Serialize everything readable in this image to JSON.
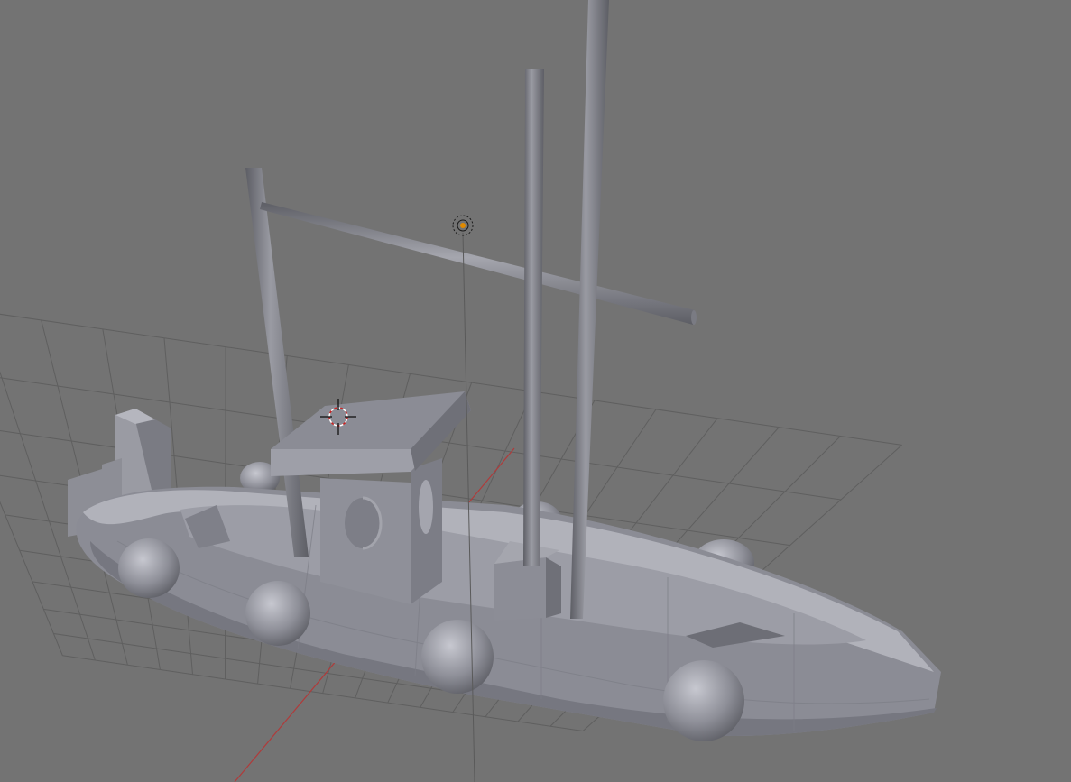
{
  "viewport": {
    "background_color": "#737373",
    "grid_color": "#5f5f5f",
    "x_axis_color": "#b03a3a",
    "mesh_color": "#8a8b94",
    "mesh_light_color": "#a4a5ae",
    "mesh_dark_color": "#6a6b73"
  },
  "scene": {
    "objects": [
      {
        "name": "boat-hull",
        "type": "mesh"
      },
      {
        "name": "cabin",
        "type": "mesh"
      },
      {
        "name": "bow-chimney",
        "type": "mesh"
      },
      {
        "name": "rear-mast",
        "type": "mesh"
      },
      {
        "name": "center-mast",
        "type": "mesh"
      },
      {
        "name": "front-mast",
        "type": "mesh"
      },
      {
        "name": "yard-boom",
        "type": "mesh"
      },
      {
        "name": "mast-base-box",
        "type": "mesh"
      },
      {
        "name": "fender-buoys",
        "type": "mesh",
        "count": 8
      }
    ],
    "helpers": [
      {
        "name": "3d-cursor",
        "icon": "crosshair-target-icon"
      },
      {
        "name": "lamp",
        "icon": "light-point-icon"
      }
    ]
  }
}
